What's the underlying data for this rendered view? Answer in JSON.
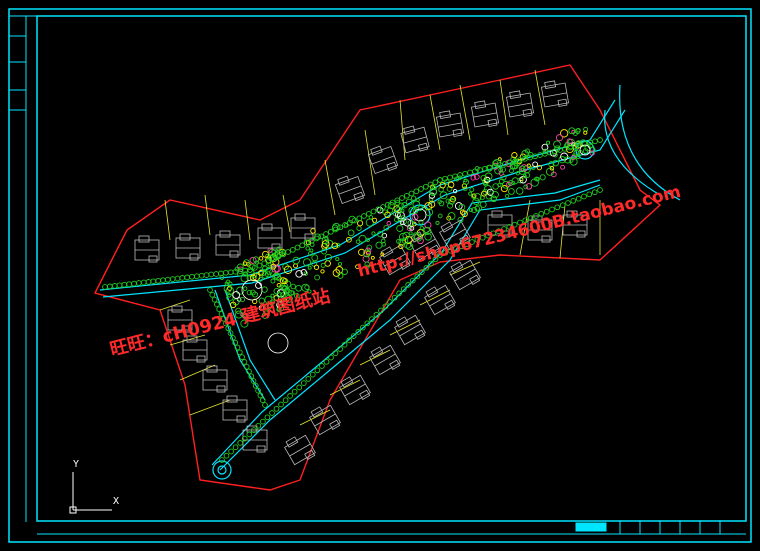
{
  "drawing": {
    "axis_labels": {
      "y": "Y",
      "x": "X"
    }
  },
  "watermarks": {
    "left": "旺旺：cH0924  建筑图纸站",
    "right": "http://shop67234600B.taobao.com"
  },
  "colors": {
    "background": "#000000",
    "frame": "#00e5ff",
    "boundary": "#ff2020",
    "plot_lines": "#e6e62e",
    "roads": "#00e5ff",
    "buildings": "#b8b8b8",
    "trees": "#22cc22",
    "flowers": "#ffee00",
    "shrubs": "#ff44aa",
    "watermark": "#ff2a2a"
  }
}
